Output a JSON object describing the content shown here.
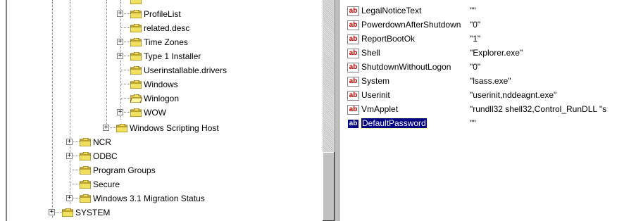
{
  "tree": {
    "items": [
      {
        "label": "ProfileList",
        "expander": "+"
      },
      {
        "label": "related.desc",
        "expander": ""
      },
      {
        "label": "Time Zones",
        "expander": "+"
      },
      {
        "label": "Type 1 Installer",
        "expander": "+"
      },
      {
        "label": "Userinstallable.drivers",
        "expander": ""
      },
      {
        "label": "Windows",
        "expander": ""
      },
      {
        "label": "Winlogon",
        "expander": ""
      },
      {
        "label": "WOW",
        "expander": "+"
      },
      {
        "label": "Windows Scripting Host",
        "expander": "+"
      },
      {
        "label": "NCR",
        "expander": "+"
      },
      {
        "label": "ODBC",
        "expander": "+"
      },
      {
        "label": "Program Groups",
        "expander": ""
      },
      {
        "label": "Secure",
        "expander": ""
      },
      {
        "label": "Windows 3.1 Migration Status",
        "expander": "+"
      },
      {
        "label": "SYSTEM",
        "expander": "+"
      }
    ]
  },
  "values": {
    "icon_text": "ab",
    "rows": [
      {
        "name": "LegalNoticeText",
        "data": "\"\""
      },
      {
        "name": "PowerdownAfterShutdown",
        "data": "\"0\""
      },
      {
        "name": "ReportBootOk",
        "data": "\"1\""
      },
      {
        "name": "Shell",
        "data": "\"Explorer.exe\""
      },
      {
        "name": "ShutdownWithoutLogon",
        "data": "\"0\""
      },
      {
        "name": "System",
        "data": "\"lsass.exe\""
      },
      {
        "name": "Userinit",
        "data": "\"userinit,nddeagnt.exe\""
      },
      {
        "name": "VmApplet",
        "data": "\"rundll32 shell32,Control_RunDLL \"s"
      },
      {
        "name": "DefaultPassword",
        "data": "\"\"",
        "selected": true
      }
    ]
  },
  "colors": {
    "folder": "#f0e060",
    "selection": "#000080",
    "ab_icon": "#c00000"
  }
}
